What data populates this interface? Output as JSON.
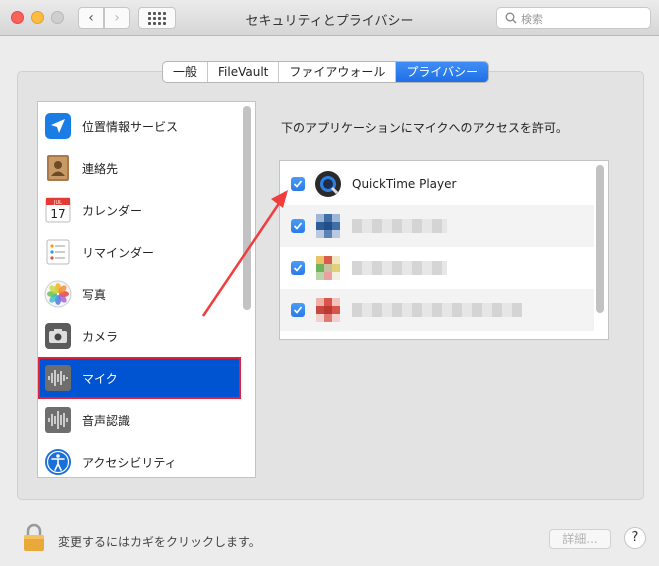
{
  "window": {
    "title": "セキュリティとプライバシー",
    "search_placeholder": "検索"
  },
  "tabs": [
    {
      "label": "一般",
      "active": false
    },
    {
      "label": "FileVault",
      "active": false
    },
    {
      "label": "ファイアウォール",
      "active": false
    },
    {
      "label": "プライバシー",
      "active": true
    }
  ],
  "sidebar": {
    "items": [
      {
        "label": "位置情報サービス",
        "icon": "location-icon"
      },
      {
        "label": "連絡先",
        "icon": "contacts-icon"
      },
      {
        "label": "カレンダー",
        "icon": "calendar-icon",
        "icon_text_top": "JUL",
        "icon_text_day": "17"
      },
      {
        "label": "リマインダー",
        "icon": "reminders-icon"
      },
      {
        "label": "写真",
        "icon": "photos-icon"
      },
      {
        "label": "カメラ",
        "icon": "camera-icon"
      },
      {
        "label": "マイク",
        "icon": "microphone-icon",
        "selected": true
      },
      {
        "label": "音声認識",
        "icon": "speech-recognition-icon"
      },
      {
        "label": "アクセシビリティ",
        "icon": "accessibility-icon"
      }
    ]
  },
  "main": {
    "description": "下のアプリケーションにマイクへのアクセスを許可。",
    "apps": [
      {
        "name": "QuickTime Player",
        "checked": true,
        "icon": "quicktime-icon"
      },
      {
        "name": "",
        "checked": true,
        "icon": "blurred-app-icon"
      },
      {
        "name": "",
        "checked": true,
        "icon": "blurred-app-icon"
      },
      {
        "name": "",
        "checked": true,
        "icon": "blurred-app-icon"
      }
    ]
  },
  "footer": {
    "lock_text": "変更するにはカギをクリックします。",
    "details_label": "詳細...",
    "help_label": "?"
  },
  "colors": {
    "selection": "#0053d1",
    "highlight_border": "#e1213b",
    "accent": "#2b7ae8",
    "annotation_arrow": "#f03e3e"
  }
}
